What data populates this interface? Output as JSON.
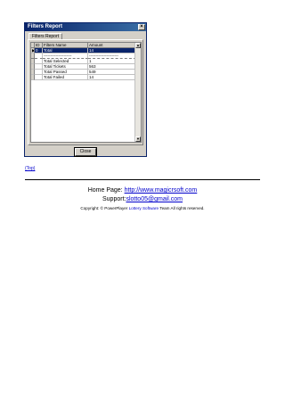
{
  "window": {
    "title": "Filters Report",
    "close_glyph": "×"
  },
  "tab": {
    "label": "Filters Report"
  },
  "grid": {
    "columns": [
      "ID",
      "Filters Name",
      "Amount"
    ],
    "rows": [
      {
        "indicator": "▶",
        "id": "0",
        "name": "Total",
        "amount": "14",
        "selected": true
      },
      {
        "indicator": "",
        "id": "",
        "name": "---------------------",
        "amount": "----------------------",
        "separator": true
      },
      {
        "indicator": "",
        "id": "",
        "name": "Total Selected",
        "amount": "1"
      },
      {
        "indicator": "",
        "id": "",
        "name": "Total Tickets",
        "amount": "563"
      },
      {
        "indicator": "",
        "id": "",
        "name": "Total Passed",
        "amount": "549"
      },
      {
        "indicator": "",
        "id": "",
        "name": "Total Failed",
        "amount": "14"
      }
    ],
    "scroll_up": "▲",
    "scroll_down": "▼"
  },
  "close_button": {
    "label": "Close"
  },
  "top_link": "(Top)",
  "footer": {
    "homepage_label": "Home Page:",
    "homepage_url": "http://www.magicrsoft.com",
    "support_label": "Support:",
    "support_email": "slotto05@gmail.com",
    "copyright_prefix": "Copyright: © PowerPlayer",
    "copyright_link": "Lottery Software",
    "copyright_suffix": "Team All rights reserved."
  }
}
